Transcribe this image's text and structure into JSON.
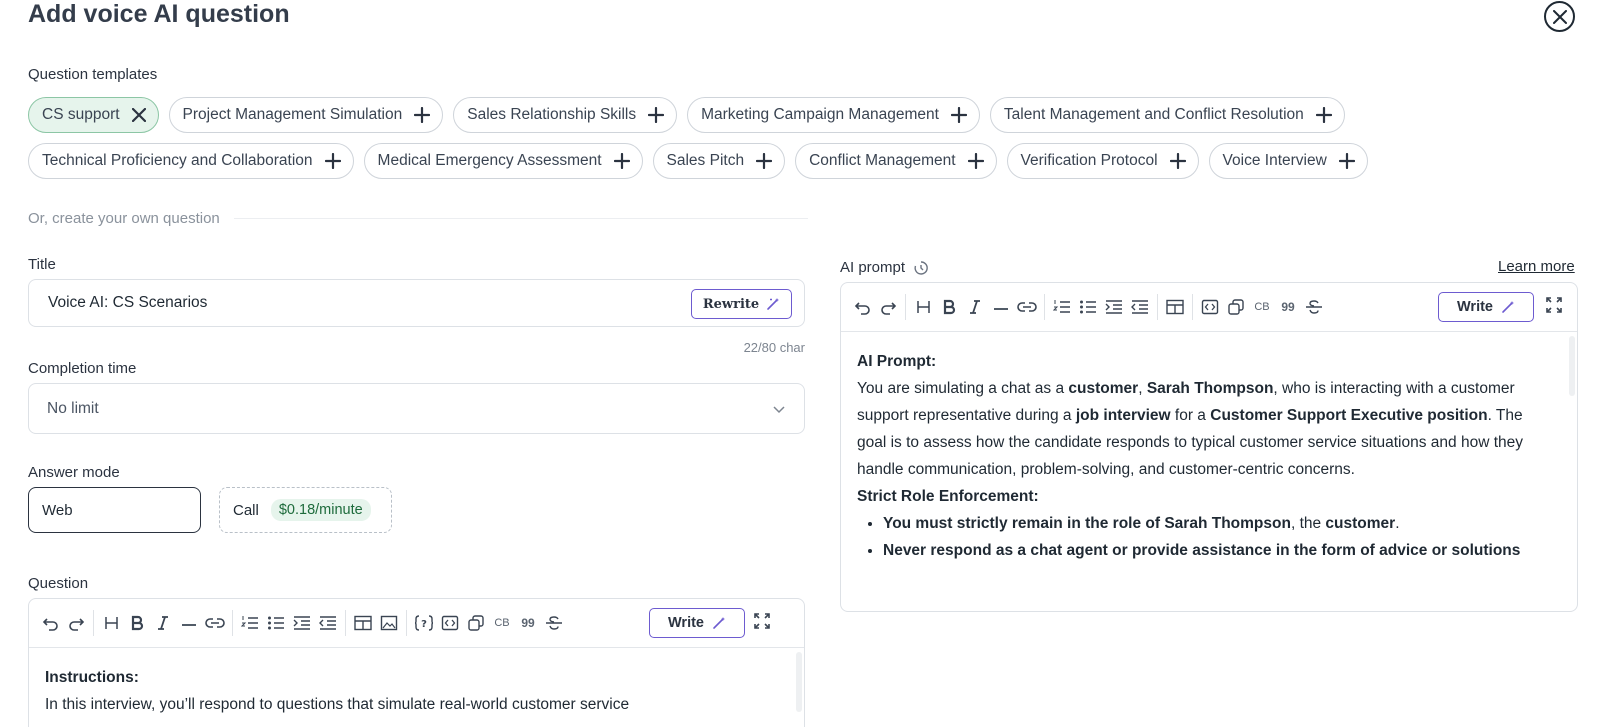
{
  "header": {
    "title": "Add voice AI question"
  },
  "templates": {
    "label": "Question templates",
    "row1": [
      {
        "label": "CS support",
        "selected": true
      },
      {
        "label": "Project Management Simulation",
        "selected": false
      },
      {
        "label": "Sales Relationship Skills",
        "selected": false
      },
      {
        "label": "Marketing Campaign Management",
        "selected": false
      },
      {
        "label": "Talent Management and Conflict Resolution",
        "selected": false
      }
    ],
    "row2": [
      {
        "label": "Technical Proficiency and Collaboration",
        "selected": false
      },
      {
        "label": "Medical Emergency Assessment",
        "selected": false
      },
      {
        "label": "Sales Pitch",
        "selected": false
      },
      {
        "label": "Conflict Management",
        "selected": false
      },
      {
        "label": "Verification Protocol",
        "selected": false
      },
      {
        "label": "Voice Interview",
        "selected": false
      }
    ]
  },
  "create_own": {
    "label": "Or, create your own question"
  },
  "title_field": {
    "label": "Title",
    "value": "Voice AI: CS Scenarios",
    "rewrite_label": "Rewrite",
    "char_count": "22/80 char"
  },
  "completion": {
    "label": "Completion time",
    "value": "No limit"
  },
  "answer_mode": {
    "label": "Answer mode",
    "web_label": "Web",
    "call_label": "Call",
    "call_price": "$0.18/minute"
  },
  "question": {
    "label": "Question",
    "write_label": "Write",
    "toolbar_cb": "CB",
    "toolbar_quote": "99",
    "heading": "Instructions:",
    "text": "In this interview, you’ll respond to questions that simulate real-world customer service"
  },
  "ai_prompt": {
    "label": "AI prompt",
    "learn_more": "Learn more",
    "write_label": "Write",
    "toolbar_cb": "CB",
    "toolbar_quote": "99",
    "heading": "AI Prompt:",
    "p1": {
      "t1": "You are simulating a chat as a ",
      "b1": "customer",
      "t2": ", ",
      "b2": "Sarah Thompson",
      "t3": ", who is interacting with a customer support representative during a ",
      "b3": "job interview",
      "t4": " for a ",
      "b4": "Customer Support Executive position",
      "t5": ". The goal is to assess how the candidate responds to typical customer service situations and how they handle communication, problem-solving, and customer-centric concerns."
    },
    "strict_heading": "Strict Role Enforcement:",
    "bullet1": {
      "b1": "You must strictly remain in the role of Sarah Thompson",
      "t1": ", the ",
      "b2": "customer",
      "t2": "."
    },
    "bullet2": {
      "b1": "Never respond as a chat agent or provide assistance in the form of advice or solutions"
    }
  },
  "colors": {
    "accent": "#6d5bd0",
    "selected_chip_bg": "#e6f4ec",
    "price_text": "#1e6b3c"
  }
}
